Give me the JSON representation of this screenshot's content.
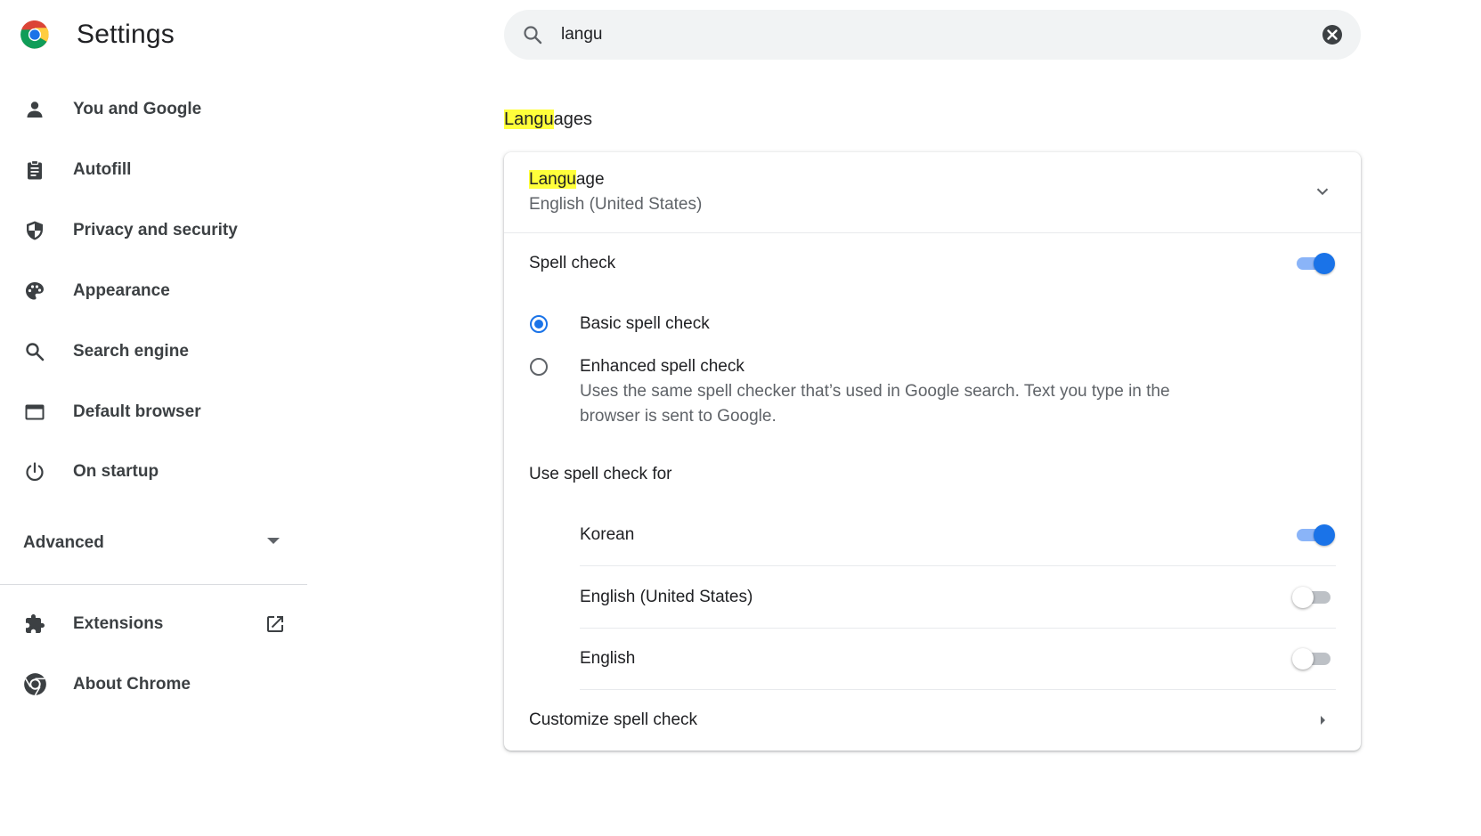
{
  "header": {
    "title": "Settings",
    "search": {
      "value": "langu",
      "placeholder": "Search settings"
    }
  },
  "sidebar": {
    "items": [
      {
        "label": "You and Google",
        "icon": "person-icon"
      },
      {
        "label": "Autofill",
        "icon": "clipboard-icon"
      },
      {
        "label": "Privacy and security",
        "icon": "shield-icon"
      },
      {
        "label": "Appearance",
        "icon": "palette-icon"
      },
      {
        "label": "Search engine",
        "icon": "search-icon"
      },
      {
        "label": "Default browser",
        "icon": "browser-window-icon"
      },
      {
        "label": "On startup",
        "icon": "power-icon"
      }
    ],
    "advanced": "Advanced",
    "extensions": "Extensions",
    "about": "About Chrome"
  },
  "main": {
    "section_title": {
      "highlight": "Langu",
      "rest": "ages"
    },
    "language": {
      "label_highlight": "Langu",
      "label_rest": "age",
      "value": "English (United States)"
    },
    "spell_check": {
      "label": "Spell check",
      "enabled": true,
      "options": [
        {
          "label": "Basic spell check",
          "checked": true
        },
        {
          "label": "Enhanced spell check",
          "checked": false,
          "description_line1": "Uses the same spell checker that’s used in Google search. Text you type in the",
          "description_line2": "browser is sent to Google."
        }
      ],
      "use_for_label": "Use spell check for",
      "languages": [
        {
          "label": "Korean",
          "enabled": true
        },
        {
          "label": "English (United States)",
          "enabled": false
        },
        {
          "label": "English",
          "enabled": false
        }
      ],
      "customize_label": "Customize spell check"
    }
  },
  "colors": {
    "accent": "#1a73e8",
    "highlight": "#ffff3b",
    "icon": "#5f6368"
  }
}
